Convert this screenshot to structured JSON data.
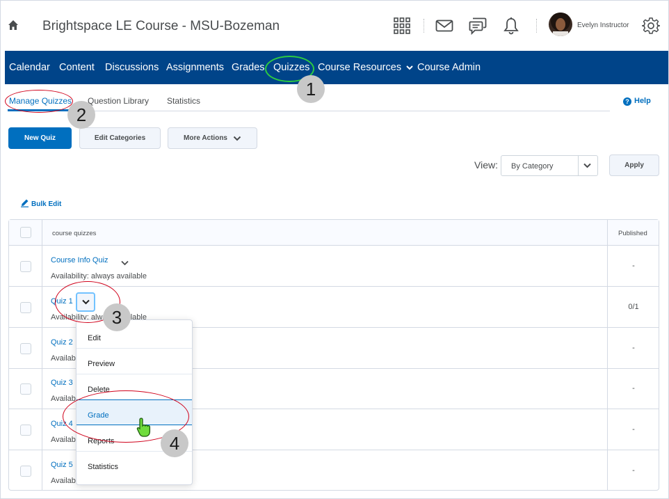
{
  "header": {
    "course_title": "Brightspace LE Course - MSU-Bozeman",
    "user_name": "Evelyn Instructor"
  },
  "navbar": {
    "items": [
      "Calendar",
      "Content",
      "Discussions",
      "Assignments",
      "Grades",
      "Quizzes",
      "Course Resources",
      "Course Admin"
    ]
  },
  "subtabs": {
    "manage": "Manage Quizzes",
    "library": "Question Library",
    "statistics": "Statistics",
    "help": "Help"
  },
  "toolbar": {
    "new_quiz": "New Quiz",
    "edit_categories": "Edit Categories",
    "more_actions": "More Actions",
    "view_label": "View:",
    "view_selected": "By Category",
    "apply": "Apply",
    "bulk_edit": "Bulk Edit"
  },
  "table": {
    "header_category": "course quizzes",
    "header_published": "Published",
    "rows": [
      {
        "name": "Course Info Quiz",
        "availability": "Availability: always available",
        "published": "-"
      },
      {
        "name": "Quiz 1",
        "availability": "Availability: always available",
        "published": "0/1"
      },
      {
        "name": "Quiz 2",
        "availability": "Availability: always available",
        "published": "-"
      },
      {
        "name": "Quiz 3",
        "availability": "Availability: always available",
        "published": "-"
      },
      {
        "name": "Quiz 4",
        "availability": "Availability: always available",
        "published": "-"
      },
      {
        "name": "Quiz 5",
        "availability": "Availability: always available",
        "published": "-"
      }
    ]
  },
  "context_menu": {
    "items": [
      "Edit",
      "Preview",
      "Delete",
      "Grade",
      "Reports",
      "Statistics"
    ]
  },
  "callouts": [
    "1",
    "2",
    "3",
    "4"
  ],
  "colors": {
    "nav_blue": "#004489",
    "link_blue": "#006fbf",
    "callout_green": "#2ecc40",
    "callout_red": "#d0021b"
  }
}
